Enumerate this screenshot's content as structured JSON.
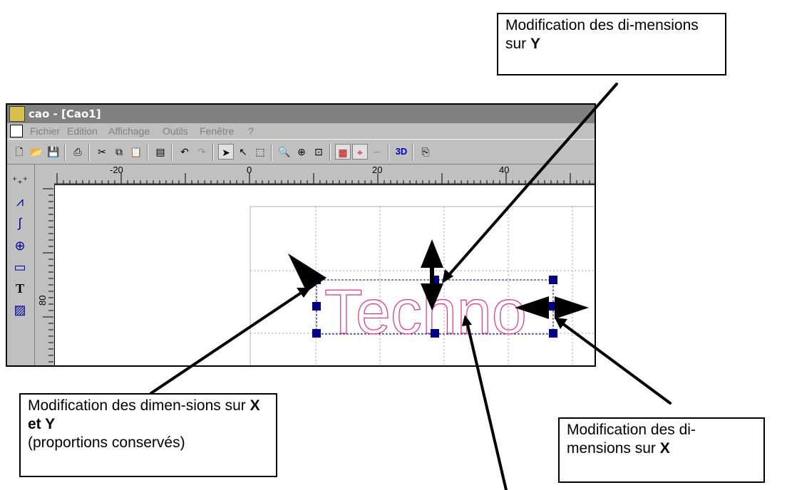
{
  "callouts": {
    "y_text": "Modification des di-mensions sur",
    "y_axis": "Y",
    "xy_text": "Modification des dimen-sions sur",
    "xy_axis": "X et Y",
    "xy_note": "(proportions conservés)",
    "x_text": "Modification des di-mensions sur",
    "x_axis": "X"
  },
  "window": {
    "title": "cao - [Cao1]",
    "menu": [
      "Fichier",
      "Edition",
      "Affichage",
      "Outils",
      "Fenêtre",
      "?"
    ]
  },
  "toolbar_icons": [
    "new-icon",
    "open-icon",
    "save-icon",
    "print-icon",
    "cut-icon",
    "copy-icon",
    "paste-icon",
    "properties-icon",
    "undo-icon",
    "redo-icon",
    "select-arrow-icon",
    "node-edit-icon",
    "zoom-window-icon",
    "zoom-page-icon",
    "zoom-in-icon",
    "zoom-selection-icon",
    "grid-snap-icon",
    "magnet-snap-icon",
    "curve-snap-icon",
    "3d-view-icon",
    "export-icon"
  ],
  "toolbar_3d_label": "3D",
  "left_tools": [
    "points-icon",
    "polyline-icon",
    "curve-icon",
    "circle-icon",
    "rectangle-icon",
    "text-icon",
    "hatch-icon"
  ],
  "left_text_tool": "T",
  "ruler": {
    "h_labels": [
      "-20",
      "0",
      "20",
      "40"
    ],
    "v_label": "80"
  },
  "canvas": {
    "text_object": "Techno",
    "text_color": "#e0308a",
    "handle_color": "#000080"
  }
}
